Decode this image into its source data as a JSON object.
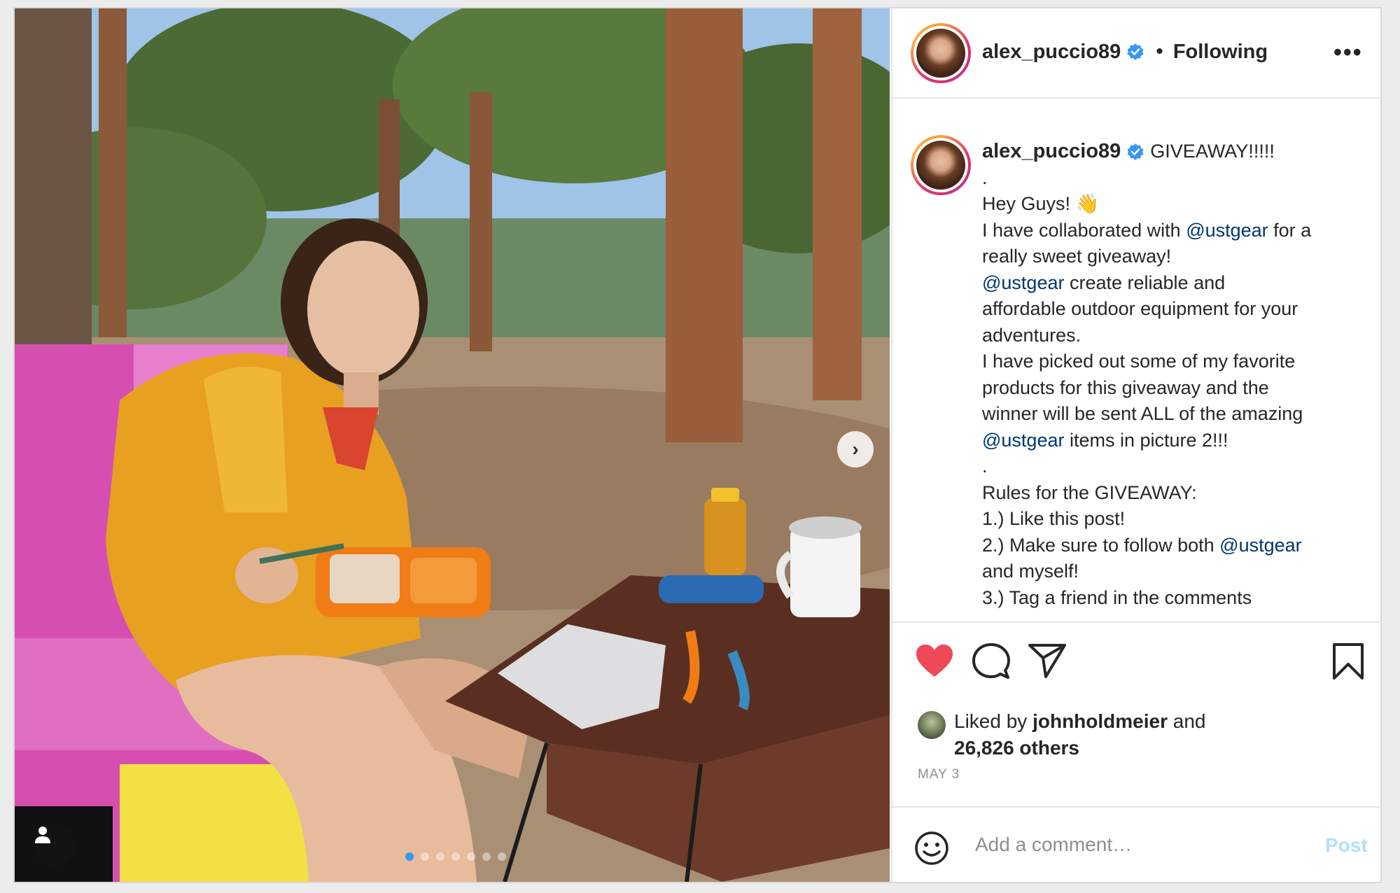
{
  "post": {
    "image_alt": "",
    "carousel": {
      "total": 7,
      "active_index": 0
    },
    "next_glyph": "›"
  },
  "header": {
    "username": "alex_puccio89",
    "verified": true,
    "bullet": "•",
    "follow_status": "Following",
    "more_label": "•••"
  },
  "caption": {
    "username": "alex_puccio89",
    "lines": [
      {
        "parts": [
          {
            "text": "GIVEAWAY!!!!!",
            "mention": false
          }
        ]
      },
      {
        "parts": [
          {
            "text": ".",
            "mention": false
          }
        ]
      },
      {
        "parts": [
          {
            "text": "Hey Guys! 👋",
            "mention": false
          }
        ]
      },
      {
        "parts": [
          {
            "text": "I have collaborated with ",
            "mention": false
          },
          {
            "text": "@ustgear",
            "mention": true
          },
          {
            "text": " for a",
            "mention": false
          }
        ]
      },
      {
        "parts": [
          {
            "text": "really sweet giveaway!",
            "mention": false
          }
        ]
      },
      {
        "parts": [
          {
            "text": "@ustgear",
            "mention": true
          },
          {
            "text": " create reliable and",
            "mention": false
          }
        ]
      },
      {
        "parts": [
          {
            "text": "affordable outdoor equipment for your",
            "mention": false
          }
        ]
      },
      {
        "parts": [
          {
            "text": "adventures.",
            "mention": false
          }
        ]
      },
      {
        "parts": [
          {
            "text": "I have picked out some of my favorite",
            "mention": false
          }
        ]
      },
      {
        "parts": [
          {
            "text": "products for this giveaway and the",
            "mention": false
          }
        ]
      },
      {
        "parts": [
          {
            "text": "winner will be sent ALL of the amazing",
            "mention": false
          }
        ]
      },
      {
        "parts": [
          {
            "text": "@ustgear",
            "mention": true
          },
          {
            "text": " items in picture 2!!!",
            "mention": false
          }
        ]
      },
      {
        "parts": [
          {
            "text": ".",
            "mention": false
          }
        ]
      },
      {
        "parts": [
          {
            "text": "Rules for the GIVEAWAY:",
            "mention": false
          }
        ]
      },
      {
        "parts": [
          {
            "text": "1.) Like this post!",
            "mention": false
          }
        ]
      },
      {
        "parts": [
          {
            "text": "2.) Make sure to follow both ",
            "mention": false
          },
          {
            "text": "@ustgear",
            "mention": true
          }
        ]
      },
      {
        "parts": [
          {
            "text": "and myself!",
            "mention": false
          }
        ]
      },
      {
        "parts": [
          {
            "text": "3.) Tag a friend in the comments",
            "mention": false
          }
        ]
      }
    ]
  },
  "actions": {
    "like_icon": "heart-icon",
    "comment_icon": "comment-icon",
    "share_icon": "paper-plane-icon",
    "save_icon": "bookmark-icon",
    "liked": true,
    "like_color": "#ed4956"
  },
  "likes": {
    "prefix": "Liked by ",
    "liker": "johnholdmeier",
    "middle": " and",
    "others": "26,826 others"
  },
  "date": "MAY 3",
  "comment": {
    "placeholder": "Add a comment…",
    "post_label": "Post"
  },
  "colors": {
    "mention": "#00376b",
    "verified": "#3897f0",
    "post_disabled": "#b2dffc"
  }
}
